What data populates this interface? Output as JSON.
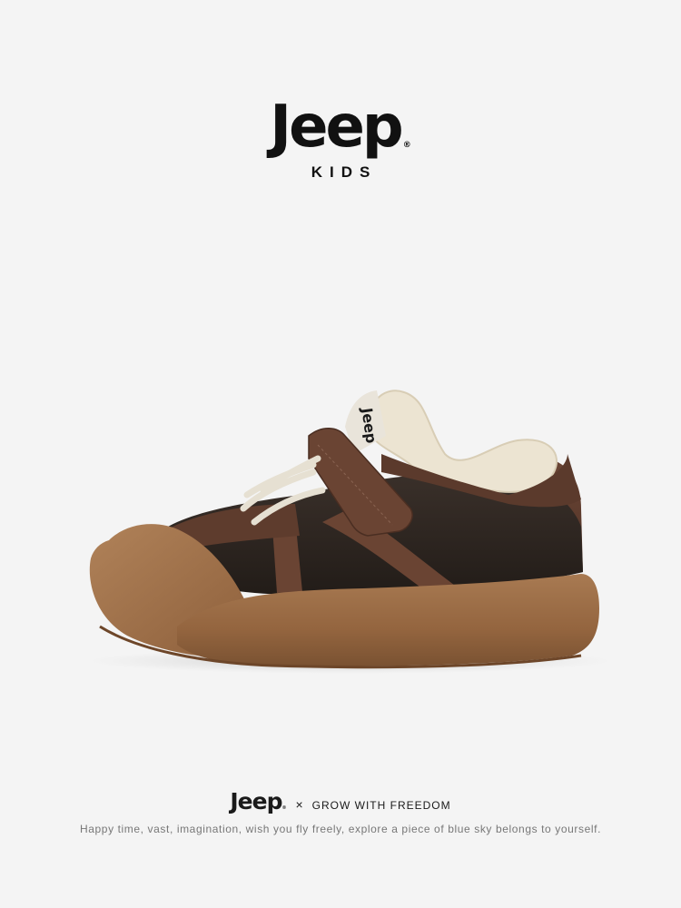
{
  "header": {
    "logo_text": "Jeep",
    "registered_mark": "®",
    "subtitle": "KIDS"
  },
  "product_image": {
    "subject": "shoe-icon",
    "tongue_label_text": "Jeep"
  },
  "footer": {
    "logo_text": "Jeep",
    "registered_mark": "®",
    "times": "×",
    "slogan": "GROW WITH FREEDOM",
    "tagline": "Happy time, vast, imagination, wish you fly freely, explore a piece of blue sky belongs to yourself."
  },
  "colors": {
    "background": "#f4f4f4",
    "sole": "#9a6b45",
    "suede": "#5b3a2c",
    "leather": "#2d2520",
    "fleece": "#ece4d2"
  }
}
